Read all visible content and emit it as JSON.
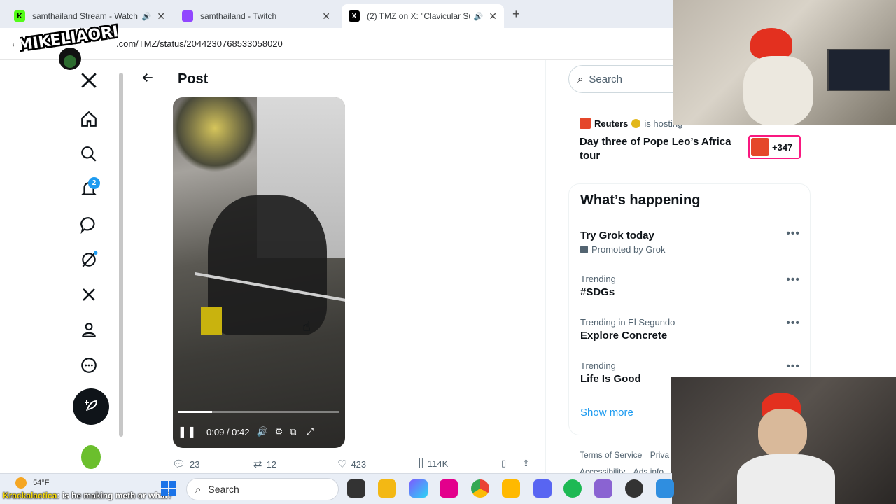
{
  "browser": {
    "tabs": [
      {
        "title": "samthailand Stream - Watch",
        "favicon": "K",
        "favicon_color": "#53fc18",
        "has_audio": true,
        "active": false
      },
      {
        "title": "samthailand - Twitch",
        "favicon": "",
        "favicon_color": "#9146ff",
        "has_audio": false,
        "active": false
      },
      {
        "title": "(2) TMZ on X: \"Clavicular Su",
        "favicon": "X",
        "favicon_color": "#000000",
        "has_audio": true,
        "active": true
      }
    ],
    "url": ".com/TMZ/status/2044230768533058020"
  },
  "overlay": {
    "logo_text": "MIKELIAORI"
  },
  "leftnav": {
    "items": [
      {
        "name": "x-logo-icon"
      },
      {
        "name": "home-icon"
      },
      {
        "name": "explore-icon"
      },
      {
        "name": "notifications-icon"
      },
      {
        "name": "messages-icon"
      },
      {
        "name": "grok-icon"
      },
      {
        "name": "premium-x-icon"
      },
      {
        "name": "profile-icon"
      },
      {
        "name": "more-icon"
      }
    ],
    "notification_count": "2"
  },
  "post": {
    "header_title": "Post",
    "video": {
      "time": "0:09 / 0:42",
      "progress": 0.21
    },
    "actions": {
      "replies": "23",
      "reposts": "12",
      "likes": "423",
      "views": "114K"
    }
  },
  "rightcol": {
    "search_placeholder": "Search",
    "live": {
      "host": "Reuters",
      "hosting": "is hosting",
      "title": "Day three of Pope Leo’s Africa tour",
      "listeners": "+347"
    },
    "happening": {
      "title": "What’s happening",
      "trends": [
        {
          "context": "",
          "name": "Try Grok today",
          "promo": "Promoted by Grok"
        },
        {
          "context": "Trending",
          "name": "#SDGs",
          "promo": ""
        },
        {
          "context": "Trending in El Segundo",
          "name": "Explore Concrete",
          "promo": ""
        },
        {
          "context": "Trending",
          "name": "Life Is Good",
          "promo": ""
        }
      ],
      "show_more": "Show more"
    },
    "footer": {
      "terms": "Terms of Service",
      "privacy": "Priva",
      "accessibility": "Accessibility",
      "ads": "Ads info"
    }
  },
  "taskbar": {
    "temperature": "54°F",
    "search_label": "Search",
    "chat_user": "Krackalactica",
    "chat_message": ": is he making meth or what?"
  },
  "colors": {
    "accent": "#1d9bf0",
    "live_border": "#f91880",
    "reuters": "#e5472a"
  }
}
